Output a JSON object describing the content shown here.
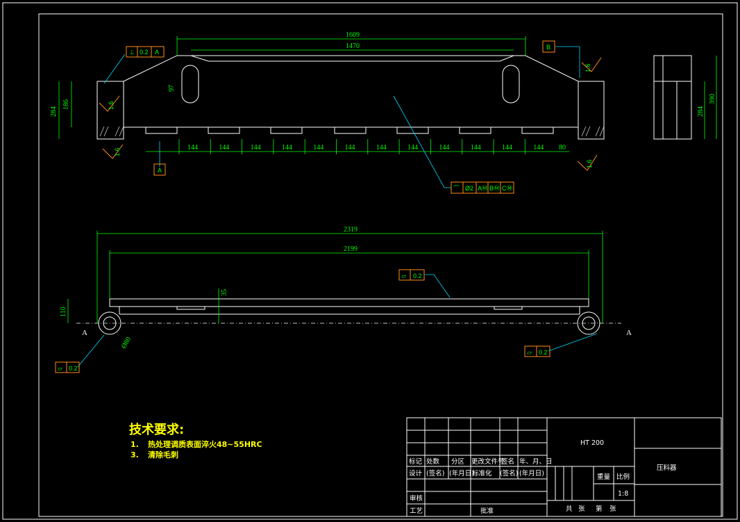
{
  "top_view": {
    "dims_horizontal": [
      "1609",
      "1470"
    ],
    "pitch_label": "144",
    "pitch_count": 12,
    "end_label": "80",
    "left_heights": [
      "284",
      "186"
    ],
    "slot_height": "97",
    "right_view_dims": [
      "284",
      "390"
    ],
    "roughness": [
      "1.6",
      "1.6",
      "1.6",
      "1.6"
    ],
    "datum_a": "A",
    "datum_b": "B",
    "tolerance_perp": {
      "symbol": "⊥",
      "value": "0.2",
      "datum": "A"
    },
    "tolerance_profile": {
      "symbol": "⌒",
      "value": "Ø2",
      "datums": [
        "AⓂ",
        "BⓂ",
        "CⓂ"
      ]
    }
  },
  "front_view": {
    "dims_horizontal": [
      "2319",
      "2199"
    ],
    "thickness": "35",
    "height": "110",
    "hole_dia": "Ø80",
    "section_marks": [
      "A",
      "A"
    ],
    "flatness_top": {
      "symbol": "▱",
      "value": "0.2"
    },
    "flatness_left": {
      "symbol": "▱",
      "value": "0.2"
    },
    "flatness_right": {
      "symbol": "▱",
      "value": "0.2"
    }
  },
  "requirements": {
    "title": "技术要求:",
    "items": [
      {
        "num": "1.",
        "text": "热处理调质表面淬火48~55HRC"
      },
      {
        "num": "3.",
        "text": "清除毛刺"
      }
    ]
  },
  "title_block": {
    "material": "HT 200",
    "part_name": "压料器",
    "scale": "1:8",
    "labels": {
      "mark": "标记",
      "count": "处数",
      "zone": "分区",
      "change_doc": "更改文件号",
      "sign": "签名",
      "date": "年、月、日",
      "design": "设计",
      "sign_paren": "(签名)",
      "date_paren": "(年月日)",
      "standard": "标准化",
      "sign_paren2": "(签名)",
      "date_paren2": "(年月日)",
      "review": "审核",
      "process": "工艺",
      "approve": "批准",
      "weight": "重量",
      "ratio": "比例",
      "total": "共",
      "sheets": "张",
      "page": "第",
      "sheet2": "张"
    }
  }
}
